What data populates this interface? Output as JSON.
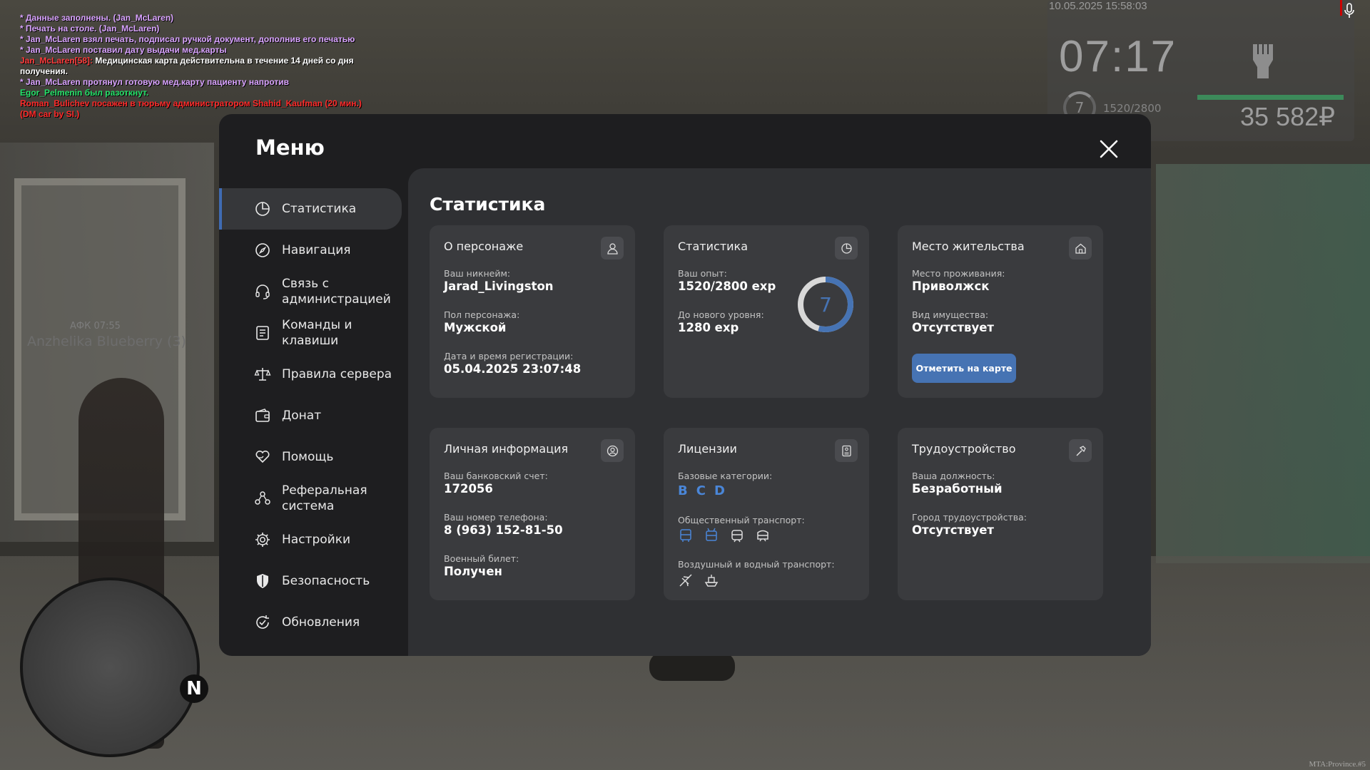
{
  "chat": [
    {
      "text": "* Данные заполнены. (Jan_McLaren)",
      "kind": "purple"
    },
    {
      "text": "* Печать на столе. (Jan_McLaren)",
      "kind": "purple"
    },
    {
      "text": "* Jan_McLaren взял печать, подписал ручкой документ, дополнив его печатью",
      "kind": "purple"
    },
    {
      "text": "* Jan_McLaren поставил дату выдачи мед.карты",
      "kind": "purple"
    },
    {
      "nick": "Jan_McLaren[58]:",
      "text": "Медицинская карта действительна в течение 14 дней со дня получения.",
      "kind": "white"
    },
    {
      "text": "* Jan_McLaren протянул готовую мед.карту пациенту напротив",
      "kind": "purple"
    },
    {
      "text": "Egor_Pelmenin был разоткнут.",
      "kind": "green"
    },
    {
      "text": "Roman_Bulichev посажен в тюрьму администратором Shahid_Kaufman (20 мин.) (DM car by SI.)",
      "kind": "red"
    }
  ],
  "hud": {
    "datetime": "10.05.2025 15:58:03",
    "time": "07:17",
    "level": "7",
    "exp": "1520/2800",
    "money": "35 582₽",
    "exp_fraction": 0.543
  },
  "world": {
    "afk": "АФК 07:55",
    "player_name": "Anzhelika Blueberry (3)",
    "watermark": "MTA:Province.#5",
    "radar_north": "N"
  },
  "menu": {
    "title": "Меню",
    "sidebar": [
      {
        "label": "Статистика",
        "icon": "pie-chart-icon",
        "active": true
      },
      {
        "label": "Навигация",
        "icon": "compass-icon",
        "active": false
      },
      {
        "label": "Связь с администрацией",
        "icon": "headset-icon",
        "active": false
      },
      {
        "label": "Команды и клавиши",
        "icon": "document-list-icon",
        "active": false
      },
      {
        "label": "Правила сервера",
        "icon": "scales-icon",
        "active": false
      },
      {
        "label": "Донат",
        "icon": "wallet-icon",
        "active": false
      },
      {
        "label": "Помощь",
        "icon": "heart-hands-icon",
        "active": false
      },
      {
        "label": "Реферальная система",
        "icon": "referral-icon",
        "active": false
      },
      {
        "label": "Настройки",
        "icon": "gear-icon",
        "active": false
      },
      {
        "label": "Безопасность",
        "icon": "shield-icon",
        "active": false
      },
      {
        "label": "Обновления",
        "icon": "refresh-check-icon",
        "active": false
      }
    ],
    "content_title": "Статистика",
    "cards": {
      "character": {
        "title": "О персонаже",
        "icon": "user-icon",
        "nickname_label": "Ваш никнейм:",
        "nickname": "Jarad_Livingston",
        "gender_label": "Пол персонажа:",
        "gender": "Мужской",
        "reg_label": "Дата и время регистрации:",
        "reg": "05.04.2025 23:07:48"
      },
      "stats": {
        "title": "Статистика",
        "icon": "pie-chart-icon",
        "exp_label": "Ваш опыт:",
        "exp": "1520/2800 exp",
        "next_label": "До нового уровня:",
        "next": "1280 exp",
        "level": "7",
        "exp_fraction": 0.543,
        "ring_color": "#4673b3"
      },
      "residence": {
        "title": "Место жительства",
        "icon": "home-icon",
        "city_label": "Место проживания:",
        "city": "Приволжск",
        "property_label": "Вид имущества:",
        "property": "Отсутствует",
        "map_button": "Отметить на карте"
      },
      "personal": {
        "title": "Личная информация",
        "icon": "user-circle-icon",
        "bank_label": "Ваш банковский счет:",
        "bank": "172056",
        "phone_label": "Ваш номер телефона:",
        "phone": "8 (963) 152-81-50",
        "military_label": "Военный билет:",
        "military": "Получен"
      },
      "licenses": {
        "title": "Лицензии",
        "icon": "id-card-icon",
        "base_label": "Базовые категории:",
        "categories": [
          "B",
          "C",
          "D"
        ],
        "public_label": "Общественный транспорт:",
        "public_icons": [
          "bus-icon",
          "trolleybus-icon",
          "tram-icon",
          "train-icon"
        ],
        "air_label": "Воздушный и водный транспорт:",
        "air_icons": [
          "plane-icon",
          "ship-icon"
        ]
      },
      "job": {
        "title": "Трудоустройство",
        "icon": "hammer-icon",
        "position_label": "Ваша должность:",
        "position": "Безработный",
        "city_label": "Город трудоустройства:",
        "city": "Отсутствует"
      }
    }
  },
  "colors": {
    "accent": "#4673b3",
    "license_active": "#4a86d8",
    "panel": "#1e1e20",
    "content": "#2f3033",
    "card": "#3a3b3e"
  }
}
